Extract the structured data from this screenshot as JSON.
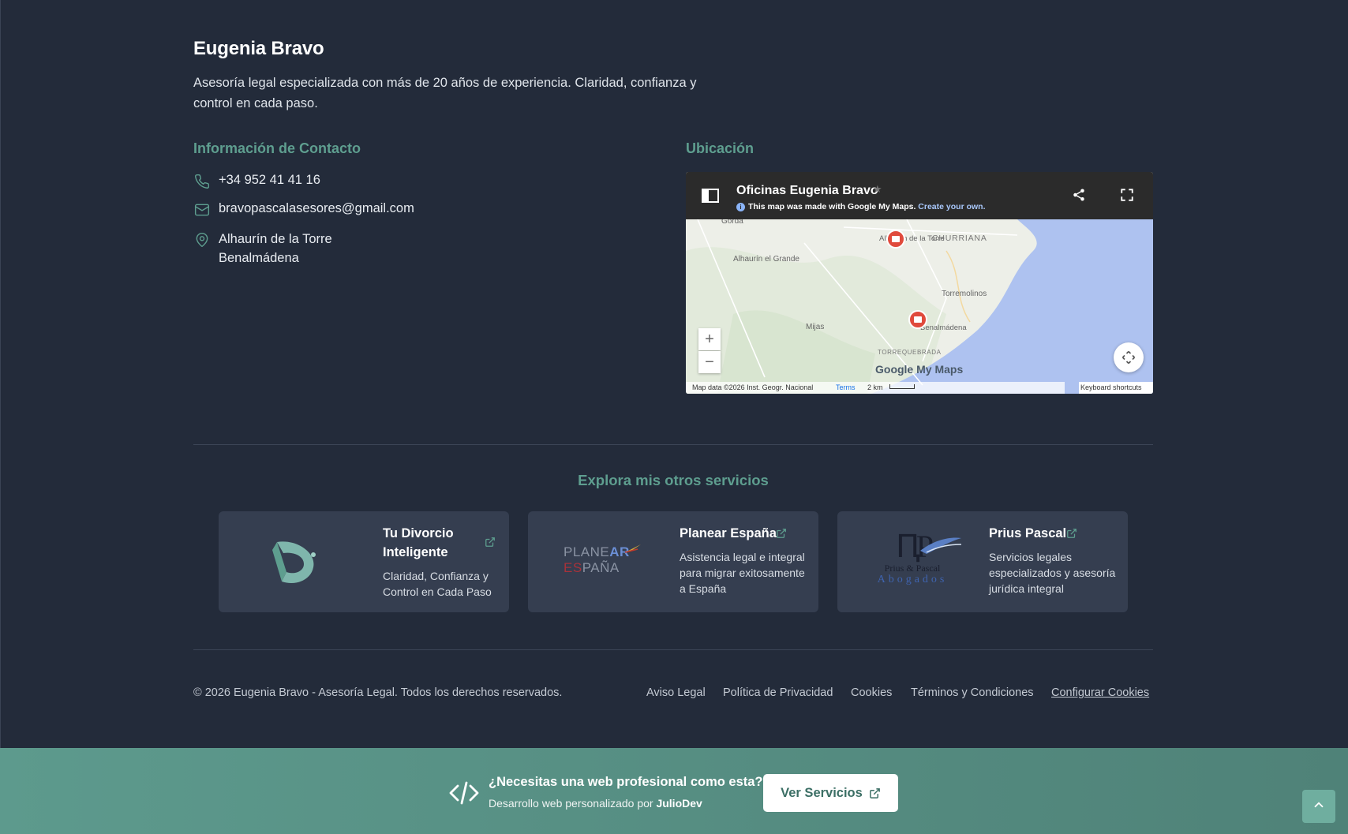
{
  "brand": {
    "name": "Eugenia Bravo",
    "tagline": "Asesoría legal especializada con más de 20 años de experiencia. Claridad, confianza y control en cada paso."
  },
  "contact": {
    "title": "Información de Contacto",
    "phone": "+34 952 41 41 16",
    "email": "bravopascalasesores@gmail.com",
    "locations": [
      "Alhaurín de la Torre",
      "Benalmádena"
    ],
    "icons": [
      "phone-icon",
      "mail-icon",
      "map-pin-icon"
    ]
  },
  "location": {
    "title": "Ubicación",
    "map": {
      "title": "Oficinas Eugenia Bravo",
      "notice": "This map was made with Google My Maps.",
      "notice_link": "Create your own.",
      "places": [
        "Gorda",
        "Alhaurín el Grande",
        "Alhaurín de la Torre",
        "CHURRIANA",
        "Torremolinos",
        "Mijas",
        "Benalmádena",
        "TORREQUEBRADA"
      ],
      "brand": "Google My Maps",
      "attribution": "Map data ©2026 Inst. Geogr. Nacional",
      "terms": "Terms",
      "scale": "2 km",
      "keyboard": "Keyboard shortcuts",
      "zoom_in": "+",
      "zoom_out": "−",
      "colors": {
        "header": "#2b2b2b",
        "sea": "#aec2f0",
        "marker": "#e04a3c"
      }
    }
  },
  "services": {
    "title": "Explora mis otros servicios",
    "cards": [
      {
        "title": "Tu Divorcio Inteligente",
        "desc": "Claridad, Confianza y Control en Cada Paso"
      },
      {
        "title": "Planear España",
        "desc": "Asistencia legal e integral para migrar exitosamente a España",
        "logo_text": [
          "PLANEAR",
          "ESPAÑA"
        ]
      },
      {
        "title": "Prius Pascal",
        "desc": "Servicios legales especializados y asesoría jurídica integral",
        "logo_text": [
          "Prius & Pascal",
          "Abogados"
        ]
      }
    ]
  },
  "footer": {
    "copyright": "© 2026 Eugenia Bravo - Asesoría Legal. Todos los derechos reservados.",
    "links": [
      "Aviso Legal",
      "Política de Privacidad",
      "Cookies",
      "Términos y Condiciones",
      "Configurar Cookies"
    ]
  },
  "banner": {
    "question": "¿Necesitas una web profesional como esta?",
    "subtitle_prefix": "Desarrollo web personalizado por",
    "subtitle_brand": "JulioDev",
    "cta": "Ver Servicios"
  },
  "colors": {
    "background": "#232b3a",
    "accent": "#5e9e8f",
    "card": "#353e50"
  }
}
